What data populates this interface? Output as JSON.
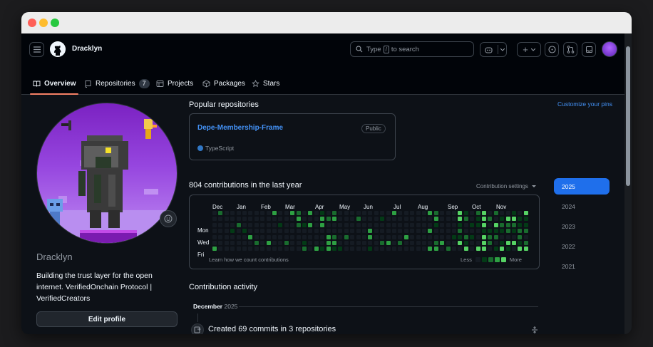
{
  "window": {
    "traffic_lights": [
      "close",
      "minimize",
      "zoom"
    ]
  },
  "header": {
    "owner": "Dracklyn",
    "search": {
      "prefix": "Type",
      "key": "/",
      "suffix": "to search"
    },
    "plus_label": "+"
  },
  "tabs": [
    {
      "label": "Overview",
      "icon": "book-icon",
      "active": true
    },
    {
      "label": "Repositories",
      "icon": "repo-icon",
      "count": "7"
    },
    {
      "label": "Projects",
      "icon": "table-icon"
    },
    {
      "label": "Packages",
      "icon": "package-icon"
    },
    {
      "label": "Stars",
      "icon": "star-icon"
    }
  ],
  "profile": {
    "username": "Dracklyn",
    "bio": "Building the trust layer for the open internet. VerifiedOnchain Protocol | VerifiedCreators",
    "edit_label": "Edit profile",
    "status_icon": "smiley-icon"
  },
  "popular": {
    "title": "Popular repositories",
    "customize": "Customize your pins",
    "repo": {
      "name": "Depe-Membership-Frame",
      "visibility": "Public",
      "language": "TypeScript",
      "language_color": "#3178c6"
    }
  },
  "contributions": {
    "title": "804 contributions in the last year",
    "settings": "Contribution settings",
    "months": [
      "Dec",
      "Jan",
      "Feb",
      "Mar",
      "Apr",
      "May",
      "Jun",
      "Jul",
      "Aug",
      "Sep",
      "Oct",
      "Nov"
    ],
    "days": [
      "Mon",
      "Wed",
      "Fri"
    ],
    "learn": "Learn how we count contributions",
    "less": "Less",
    "more": "More",
    "palette": [
      "#151b23",
      "#033a16",
      "#196c2e",
      "#2ea043",
      "#56d364"
    ]
  },
  "years": [
    "2025",
    "2024",
    "2023",
    "2022",
    "2021"
  ],
  "activity": {
    "title": "Contribution activity",
    "month": "December",
    "year": "2025",
    "item": "Created 69 commits in 3 repositories"
  }
}
